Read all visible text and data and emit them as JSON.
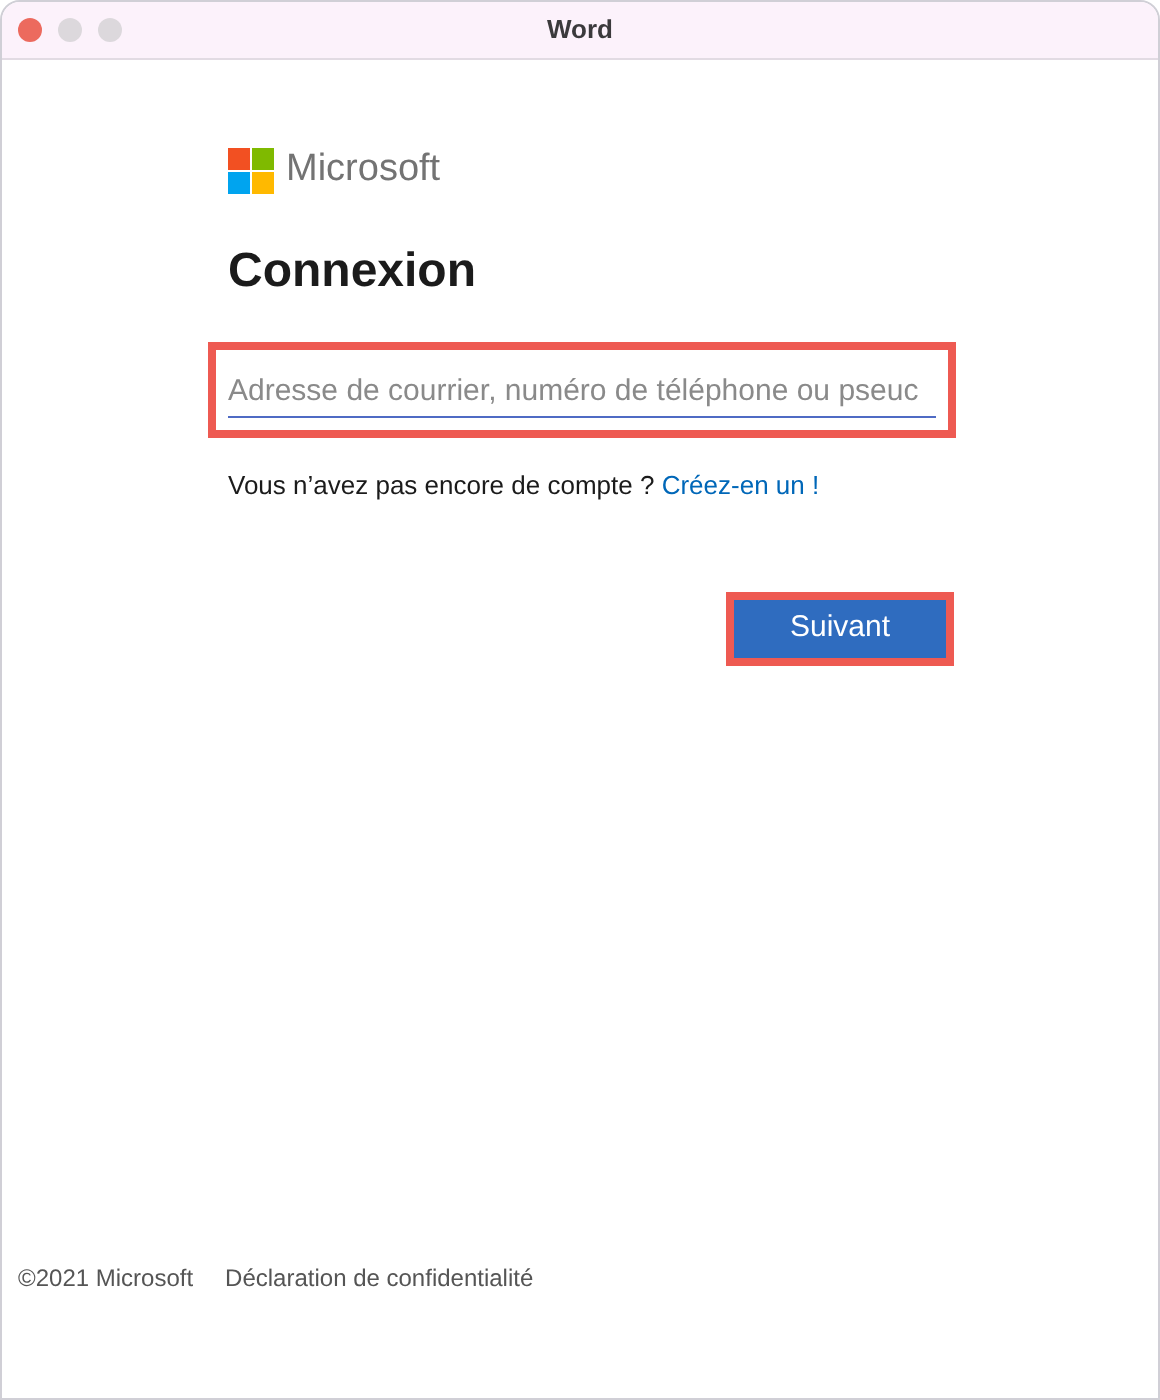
{
  "window": {
    "title": "Word"
  },
  "brand": {
    "name": "Microsoft"
  },
  "heading": "Connexion",
  "field": {
    "placeholder": "Adresse de courrier, numéro de téléphone ou pseuc"
  },
  "no_account": {
    "text": "Vous n’avez pas encore de compte ?",
    "link": "Créez-en un !"
  },
  "next_button": "Suivant",
  "footer": {
    "copyright": "©2021 Microsoft",
    "privacy_link": "Déclaration de confidentialité"
  }
}
